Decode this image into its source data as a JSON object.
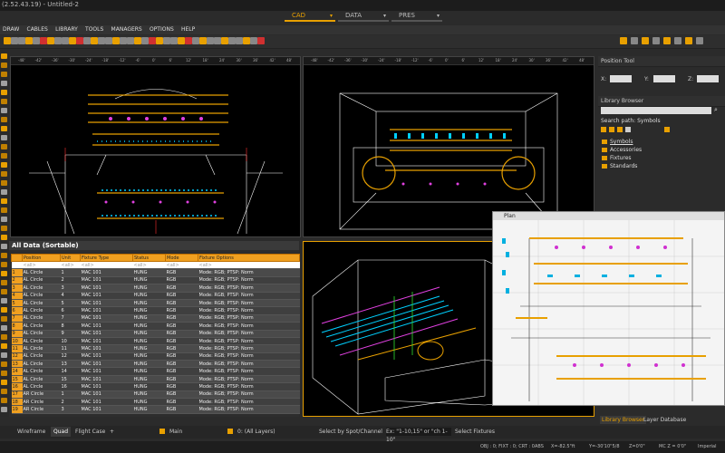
{
  "window": {
    "title": "(2.52.43.19) - Untitled-2"
  },
  "mode_tabs": [
    {
      "label": "CAD",
      "active": true
    },
    {
      "label": "DATA",
      "active": false
    },
    {
      "label": "PRES",
      "active": false
    }
  ],
  "menu": [
    "DRAW",
    "CABLES",
    "LIBRARY",
    "TOOLS",
    "MANAGERS",
    "OPTIONS",
    "HELP"
  ],
  "colors": {
    "accent": "#e8a000",
    "viewport_bg": "#000000",
    "panel_bg": "#2b2b2b"
  },
  "viewports": {
    "ruler_labels": [
      "-48'",
      "-42'",
      "-36'",
      "-30'",
      "-24'",
      "-18'",
      "-12'",
      "-6'",
      "0'",
      "6'",
      "12'",
      "18'",
      "24'",
      "30'",
      "36'",
      "42'",
      "48'"
    ]
  },
  "position_tool": {
    "title": "Position Tool",
    "x_label": "X:",
    "y_label": "Y:",
    "z_label": "Z:"
  },
  "library_browser": {
    "title": "Library Browser",
    "search_path_label": "Search path: Symbols",
    "tree": [
      "Symbols",
      "Accessories",
      "Fixtures",
      "Standards"
    ]
  },
  "data_panel": {
    "title": "All Data (Sortable)",
    "columns": [
      "Position",
      "Unit",
      "Fixture Type",
      "Status",
      "Mode",
      "Fixture Options"
    ],
    "filter_row": [
      "<all>",
      "<all>",
      "<all>",
      "<all>",
      "<all>",
      "<all>"
    ],
    "rows": [
      [
        "1",
        "AL Circle",
        "1",
        "MAC 101",
        "HUNG",
        "RGB",
        "Mode: RGB; PTSP: Norm"
      ],
      [
        "2",
        "AL Circle",
        "2",
        "MAC 101",
        "HUNG",
        "RGB",
        "Mode: RGB; PTSP: Norm"
      ],
      [
        "3",
        "AL Circle",
        "3",
        "MAC 101",
        "HUNG",
        "RGB",
        "Mode: RGB; PTSP: Norm"
      ],
      [
        "4",
        "AL Circle",
        "4",
        "MAC 101",
        "HUNG",
        "RGB",
        "Mode: RGB; PTSP: Norm"
      ],
      [
        "5",
        "AL Circle",
        "5",
        "MAC 101",
        "HUNG",
        "RGB",
        "Mode: RGB; PTSP: Norm"
      ],
      [
        "6",
        "AL Circle",
        "6",
        "MAC 101",
        "HUNG",
        "RGB",
        "Mode: RGB; PTSP: Norm"
      ],
      [
        "7",
        "AL Circle",
        "7",
        "MAC 101",
        "HUNG",
        "RGB",
        "Mode: RGB; PTSP: Norm"
      ],
      [
        "8",
        "AL Circle",
        "8",
        "MAC 101",
        "HUNG",
        "RGB",
        "Mode: RGB; PTSP: Norm"
      ],
      [
        "9",
        "AL Circle",
        "9",
        "MAC 101",
        "HUNG",
        "RGB",
        "Mode: RGB; PTSP: Norm"
      ],
      [
        "10",
        "AL Circle",
        "10",
        "MAC 101",
        "HUNG",
        "RGB",
        "Mode: RGB; PTSP: Norm"
      ],
      [
        "11",
        "AL Circle",
        "11",
        "MAC 101",
        "HUNG",
        "RGB",
        "Mode: RGB; PTSP: Norm"
      ],
      [
        "12",
        "AL Circle",
        "12",
        "MAC 101",
        "HUNG",
        "RGB",
        "Mode: RGB; PTSP: Norm"
      ],
      [
        "13",
        "AL Circle",
        "13",
        "MAC 101",
        "HUNG",
        "RGB",
        "Mode: RGB; PTSP: Norm"
      ],
      [
        "14",
        "AL Circle",
        "14",
        "MAC 101",
        "HUNG",
        "RGB",
        "Mode: RGB; PTSP: Norm"
      ],
      [
        "15",
        "AL Circle",
        "15",
        "MAC 101",
        "HUNG",
        "RGB",
        "Mode: RGB; PTSP: Norm"
      ],
      [
        "16",
        "AL Circle",
        "16",
        "MAC 101",
        "HUNG",
        "RGB",
        "Mode: RGB; PTSP: Norm"
      ],
      [
        "17",
        "AR Circle",
        "1",
        "MAC 101",
        "HUNG",
        "RGB",
        "Mode: RGB; PTSP: Norm"
      ],
      [
        "18",
        "AR Circle",
        "2",
        "MAC 101",
        "HUNG",
        "RGB",
        "Mode: RGB; PTSP: Norm"
      ],
      [
        "19",
        "AR Circle",
        "3",
        "MAC 101",
        "HUNG",
        "RGB",
        "Mode: RGB; PTSP: Norm"
      ]
    ]
  },
  "plan_window": {
    "title": "Plan"
  },
  "bottom_tabs": [
    {
      "label": "Wireframe",
      "active": false
    },
    {
      "label": "Quad",
      "active": true
    },
    {
      "label": "Flight Case",
      "active": false
    },
    {
      "label": "+",
      "active": false
    }
  ],
  "bottom_bar": {
    "layer_main": "Main",
    "layer_all": "0: (All Layers)",
    "select_mode": "Select by Spot/Channel",
    "select_example": "Ex: \"1-10,15\" or \"ch 1-10\"",
    "select_fixtures": "Select Fixtures"
  },
  "right_tabs": [
    {
      "label": "Library Browser",
      "active": true
    },
    {
      "label": "Layer Database",
      "active": false
    }
  ],
  "status": {
    "obj": "OBJ : 0; FIXT : 0; CRT : 0",
    "abs": "ABS",
    "x": "X=-82.5\"ft",
    "y": "Y=-30'10\"5/8",
    "z": "Z=0'0\"",
    "mc": "MC Z = 0'0\"",
    "units": "Imperial"
  }
}
